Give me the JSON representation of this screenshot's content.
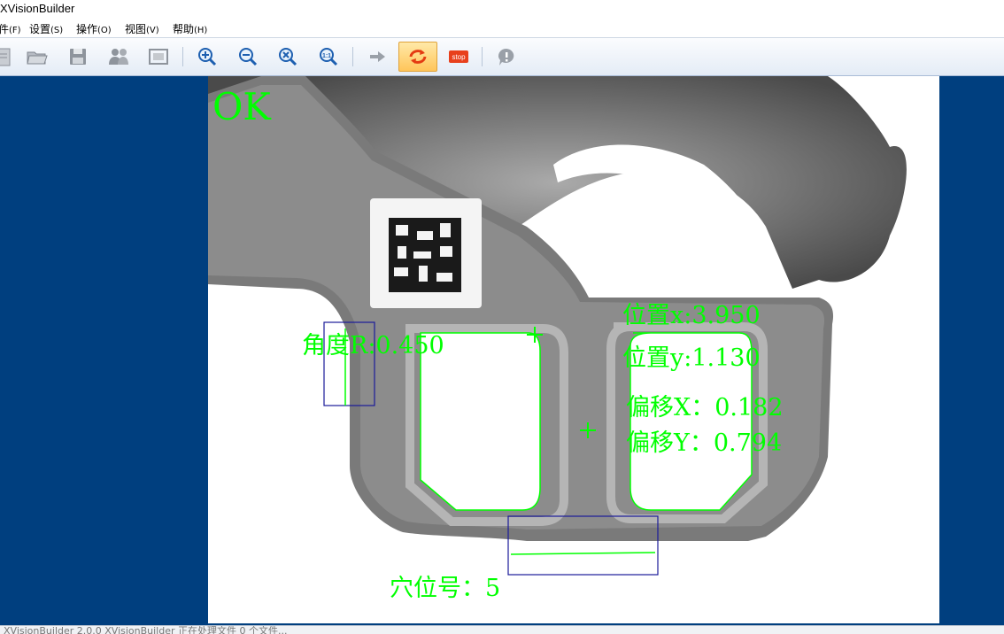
{
  "window": {
    "title": "XVisionBuilder"
  },
  "menu": [
    {
      "label": "件",
      "accel": "(F)"
    },
    {
      "label": "设置",
      "accel": "(S)"
    },
    {
      "label": "操作",
      "accel": "(O)"
    },
    {
      "label": "视图",
      "accel": "(V)"
    },
    {
      "label": "帮助",
      "accel": "(H)"
    }
  ],
  "toolbar": {
    "stop_label": "stop",
    "zoom_actual_label": "1:1",
    "icons": [
      "new-icon",
      "open-folder-icon",
      "save-icon",
      "users-icon",
      "fit-window-icon",
      "zoom-in-icon",
      "zoom-out-icon",
      "zoom-reset-icon",
      "zoom-actual-icon",
      "arrow-right-icon",
      "loop-run-icon",
      "stop-icon",
      "help-icon"
    ]
  },
  "result": {
    "status": "OK",
    "angle_label": "角度R:0.450",
    "pos_x_label": "位置x:3.950",
    "pos_y_label": "位置y:1.130",
    "offset_x_label": "偏移X：0.182",
    "offset_y_label": "偏移Y：0.794",
    "hole_label": "穴位号：5"
  },
  "colors": {
    "overlay_text": "#00ff00",
    "roi_box": "#1a1a9a",
    "workspace_bg": "#003f7f",
    "active_button": "#ffc55a"
  },
  "statusbar": {
    "text": "XVisionBuilder 2.0.0 XVisionBuilder 正在处理文件 0 个文件..."
  }
}
